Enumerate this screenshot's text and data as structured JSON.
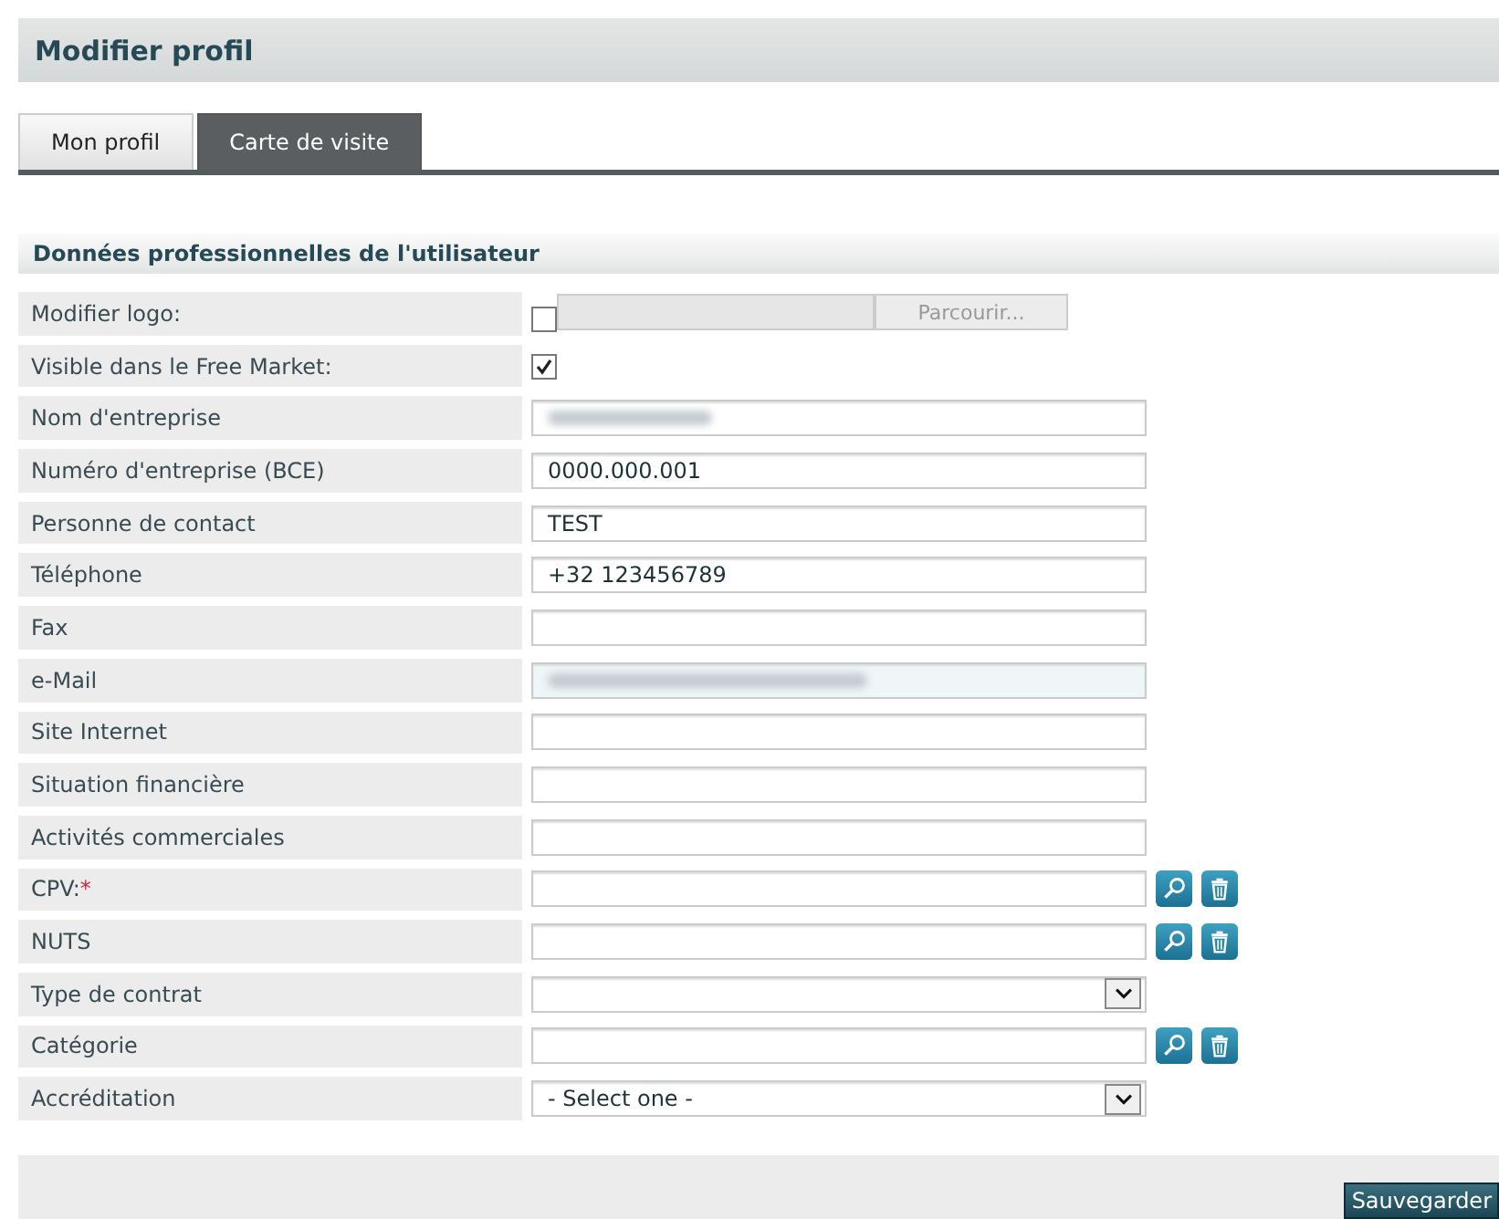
{
  "page_title": "Modifier profil",
  "tabs": [
    {
      "label": "Mon profil",
      "selected": false
    },
    {
      "label": "Carte de visite",
      "selected": true
    }
  ],
  "section_title": "Données professionnelles de l'utilisateur",
  "fields": [
    {
      "kind": "file",
      "label": "Modifier logo:",
      "checked": false,
      "button": "Parcourir..."
    },
    {
      "kind": "checkbox",
      "label": "Visible dans le Free Market:",
      "checked": true
    },
    {
      "kind": "text",
      "label": "Nom d'entreprise",
      "redacted": true
    },
    {
      "kind": "text",
      "label": "Numéro d'entreprise (BCE)",
      "value": "0000.000.001"
    },
    {
      "kind": "text",
      "label": "Personne de contact",
      "value": "TEST"
    },
    {
      "kind": "text",
      "label": "Téléphone",
      "value": "+32 123456789"
    },
    {
      "kind": "text",
      "label": "Fax"
    },
    {
      "kind": "text",
      "label": "e-Mail",
      "redacted": true,
      "highlighted": true
    },
    {
      "kind": "text",
      "label": "Site Internet"
    },
    {
      "kind": "text",
      "label": "Situation financière"
    },
    {
      "kind": "text",
      "label": "Activités commerciales"
    },
    {
      "kind": "lookup",
      "label": "CPV:",
      "required_mark": "*"
    },
    {
      "kind": "lookup",
      "label": "NUTS"
    },
    {
      "kind": "select",
      "label": "Type de contrat"
    },
    {
      "kind": "lookup",
      "label": "Catégorie"
    },
    {
      "kind": "select",
      "label": "Accréditation",
      "value": "- Select one -"
    }
  ],
  "save_button": "Sauvegarder"
}
